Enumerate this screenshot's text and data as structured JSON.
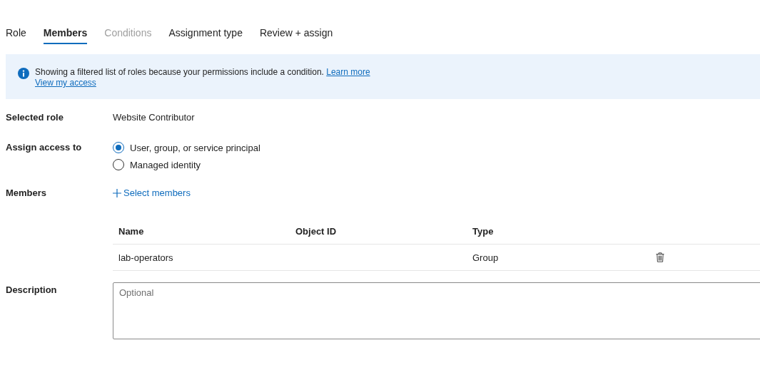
{
  "tabs": [
    {
      "label": "Role",
      "selected": false,
      "disabled": false
    },
    {
      "label": "Members",
      "selected": true,
      "disabled": false
    },
    {
      "label": "Conditions",
      "selected": false,
      "disabled": true
    },
    {
      "label": "Assignment type",
      "selected": false,
      "disabled": false
    },
    {
      "label": "Review + assign",
      "selected": false,
      "disabled": false
    }
  ],
  "banner": {
    "message": "Showing a filtered list of roles because your permissions include a condition.",
    "learn_more": "Learn more",
    "view_access": "View my access"
  },
  "selected_role": {
    "label": "Selected role",
    "value": "Website Contributor"
  },
  "assign_access": {
    "label": "Assign access to",
    "options": [
      {
        "label": "User, group, or service principal",
        "selected": true
      },
      {
        "label": "Managed identity",
        "selected": false
      }
    ]
  },
  "members": {
    "label": "Members",
    "select_link": "Select members",
    "columns": [
      "Name",
      "Object ID",
      "Type"
    ],
    "rows": [
      {
        "name": "lab-operators",
        "object_id": "",
        "type": "Group"
      }
    ]
  },
  "description": {
    "label": "Description",
    "placeholder": "Optional"
  }
}
